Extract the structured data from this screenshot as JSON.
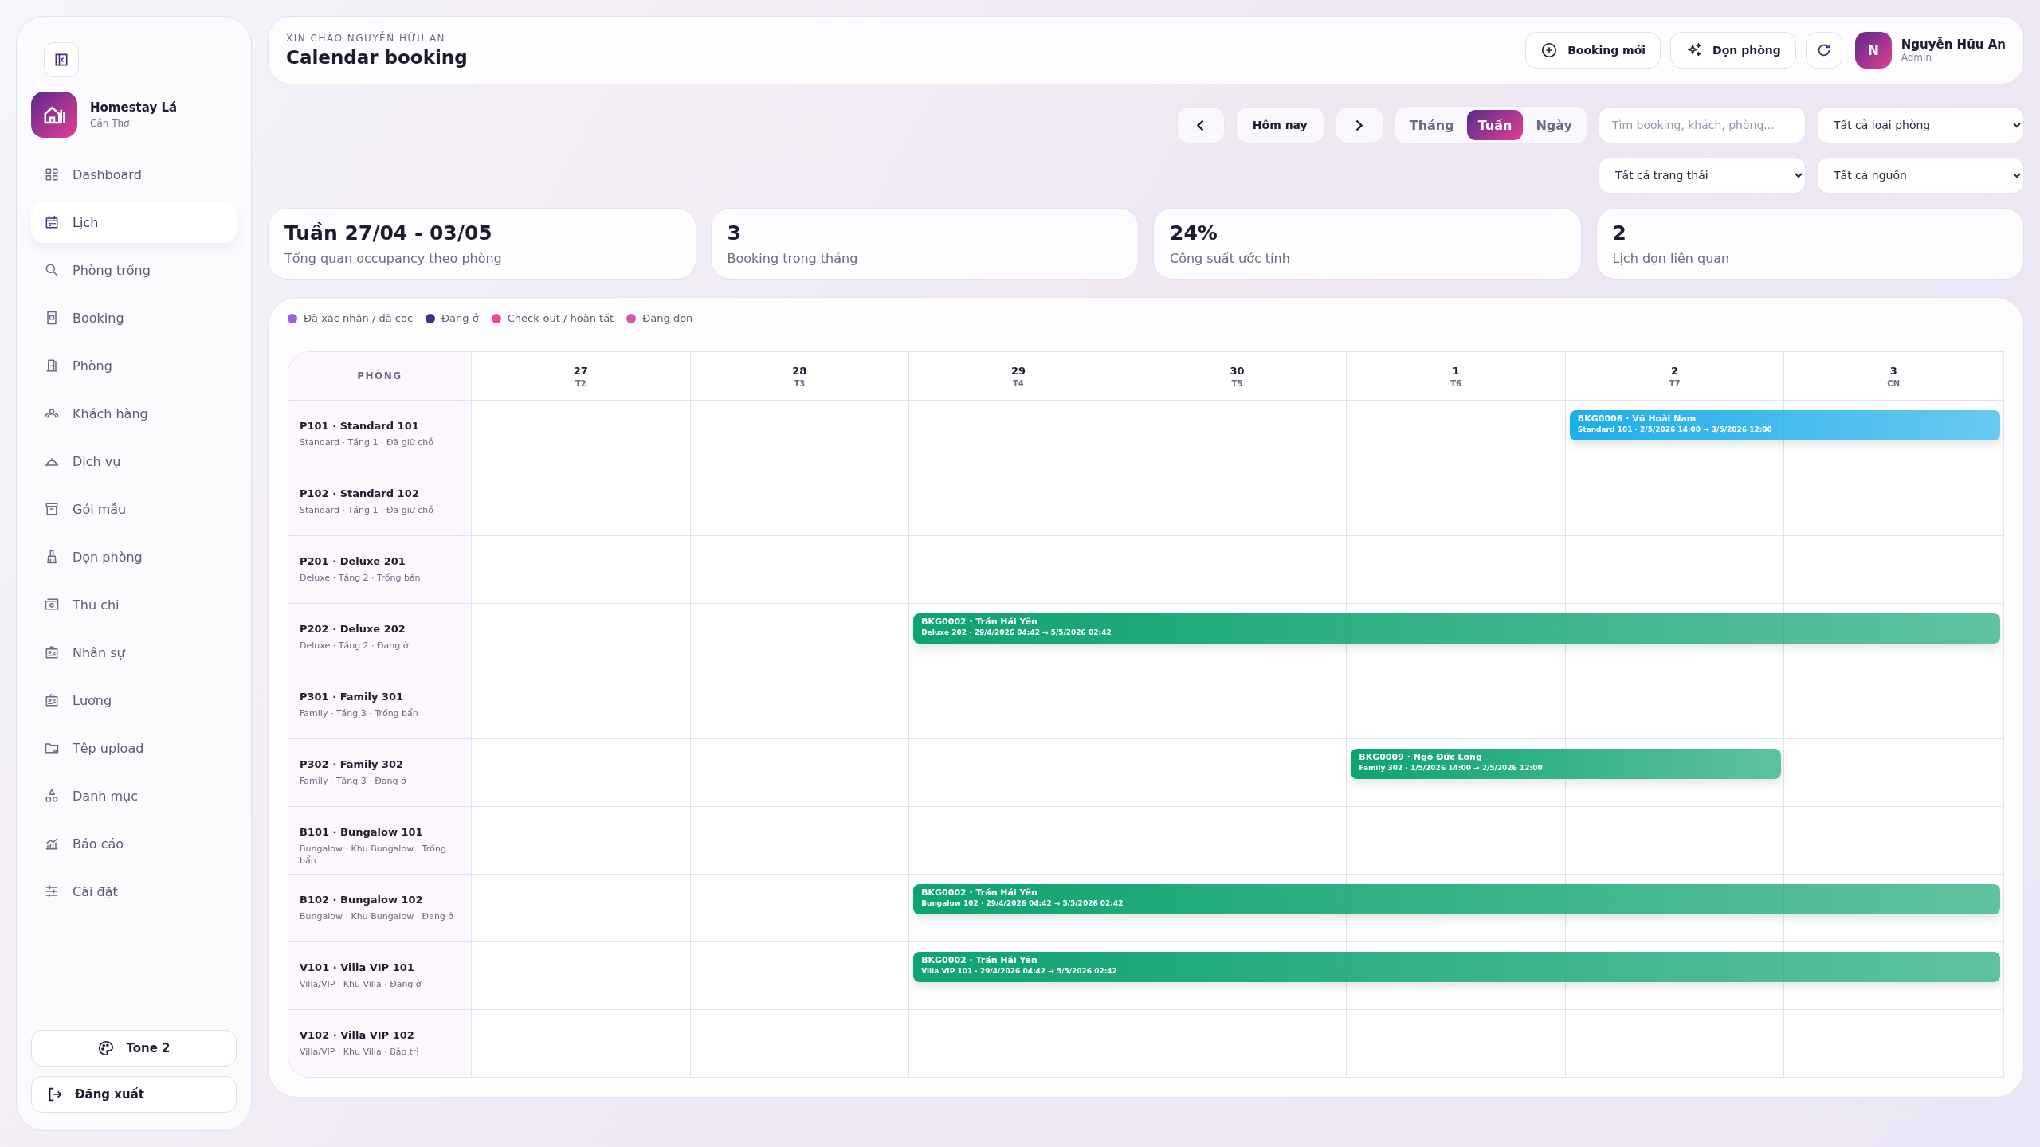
{
  "sidebar": {
    "brand": {
      "name": "Homestay Lá",
      "location": "Cần Thơ"
    },
    "items": [
      {
        "label": "Dashboard",
        "selected": false
      },
      {
        "label": "Lịch",
        "selected": true
      },
      {
        "label": "Phòng trống",
        "selected": false
      },
      {
        "label": "Booking",
        "selected": false
      },
      {
        "label": "Phòng",
        "selected": false
      },
      {
        "label": "Khách hàng",
        "selected": false
      },
      {
        "label": "Dịch vụ",
        "selected": false
      },
      {
        "label": "Gói mẫu",
        "selected": false
      },
      {
        "label": "Dọn phòng",
        "selected": false
      },
      {
        "label": "Thu chi",
        "selected": false
      },
      {
        "label": "Nhân sự",
        "selected": false
      },
      {
        "label": "Lương",
        "selected": false
      },
      {
        "label": "Tệp upload",
        "selected": false
      },
      {
        "label": "Danh mục",
        "selected": false
      },
      {
        "label": "Báo cáo",
        "selected": false
      },
      {
        "label": "Cài đặt",
        "selected": false
      }
    ],
    "theme_button": "Tone 2",
    "logout_button": "Đăng xuất"
  },
  "header": {
    "greeting": "XIN CHÀO NGUYỄN HỮU AN",
    "title": "Calendar booking",
    "new_booking_button": "Booking mới",
    "cleaning_button": "Dọn phòng",
    "user": {
      "initial": "N",
      "name": "Nguyễn Hữu An",
      "role": "Admin"
    }
  },
  "toolbar": {
    "today_button": "Hôm nay",
    "views": [
      {
        "label": "Tháng",
        "selected": false
      },
      {
        "label": "Tuần",
        "selected": true
      },
      {
        "label": "Ngày",
        "selected": false
      }
    ],
    "search": {
      "placeholder": "Tìm booking, khách, phòng..."
    },
    "room_type_filter": "Tất cả loại phòng",
    "status_filter": "Tất cả trạng thái",
    "source_filter": "Tất cả nguồn"
  },
  "stats": [
    {
      "value": "Tuần 27/04 - 03/05",
      "label": "Tổng quan occupancy theo phòng"
    },
    {
      "value": "3",
      "label": "Booking trong tháng"
    },
    {
      "value": "24%",
      "label": "Công suất ước tính"
    },
    {
      "value": "2",
      "label": "Lịch dọn liên quan"
    }
  ],
  "legend": [
    {
      "label": "Đã xác nhận / đã cọc",
      "color": "#9b63d9"
    },
    {
      "label": "Đang ở",
      "color": "#4a2d80"
    },
    {
      "label": "Check-out / hoàn tất",
      "color": "#ec4899"
    },
    {
      "label": "Đang dọn",
      "color": "#d45aa8"
    }
  ],
  "calendar": {
    "room_header": "PHÒNG",
    "days": [
      {
        "date": "27",
        "weekday": "T2"
      },
      {
        "date": "28",
        "weekday": "T3"
      },
      {
        "date": "29",
        "weekday": "T4"
      },
      {
        "date": "30",
        "weekday": "T5"
      },
      {
        "date": "1",
        "weekday": "T6"
      },
      {
        "date": "2",
        "weekday": "T7"
      },
      {
        "date": "3",
        "weekday": "CN"
      }
    ],
    "rooms": [
      {
        "name": "P101 · Standard 101",
        "detail": "Standard · Tầng 1 · Đã giữ chỗ",
        "bookings": [
          {
            "title": "BKG0006 · Vũ Hoài Nam",
            "detail": "Standard 101 · 2/5/2026 14:00 → 3/5/2026 12:00",
            "color": "#1eaeea"
          }
        ]
      },
      {
        "name": "P102 · Standard 102",
        "detail": "Standard · Tầng 1 · Đã giữ chỗ"
      },
      {
        "name": "P201 · Deluxe 201",
        "detail": "Deluxe · Tầng 2 · Trống bẩn"
      },
      {
        "name": "P202 · Deluxe 202",
        "detail": "Deluxe · Tầng 2 · Đang ở",
        "bookings": [
          {
            "title": "BKG0002 · Trần Hái Yên",
            "detail": "Deluxe 202 · 29/4/2026 04:42 → 5/5/2026 02:42",
            "color": "#0ea371"
          }
        ]
      },
      {
        "name": "P301 · Family 301",
        "detail": "Family · Tầng 3 · Trống bẩn"
      },
      {
        "name": "P302 · Family 302",
        "detail": "Family · Tầng 3 · Đang ở",
        "bookings": [
          {
            "title": "BKG0009 · Ngô Đức Long",
            "detail": "Family 302 · 1/5/2026 14:00 → 2/5/2026 12:00",
            "color": "#0ea371"
          }
        ]
      },
      {
        "name": "B101 · Bungalow 101",
        "detail": "Bungalow · Khu Bungalow · Trống bẩn"
      },
      {
        "name": "B102 · Bungalow 102",
        "detail": "Bungalow · Khu Bungalow · Đang ở",
        "bookings": [
          {
            "title": "BKG0002 · Trần Hái Yên",
            "detail": "Bungalow 102 · 29/4/2026 04:42 → 5/5/2026 02:42",
            "color": "#0ea371"
          }
        ]
      },
      {
        "name": "V101 · Villa VIP 101",
        "detail": "Villa/VIP · Khu Villa · Đang ở",
        "bookings": [
          {
            "title": "BKG0002 · Trần Hái Yên",
            "detail": "Villa VIP 101 · 29/4/2026 04:42 → 5/5/2026 02:42",
            "color": "#0ea371"
          }
        ]
      },
      {
        "name": "V102 · Villa VIP 102",
        "detail": "Villa/VIP · Khu Villa · Bảo trì"
      }
    ]
  }
}
